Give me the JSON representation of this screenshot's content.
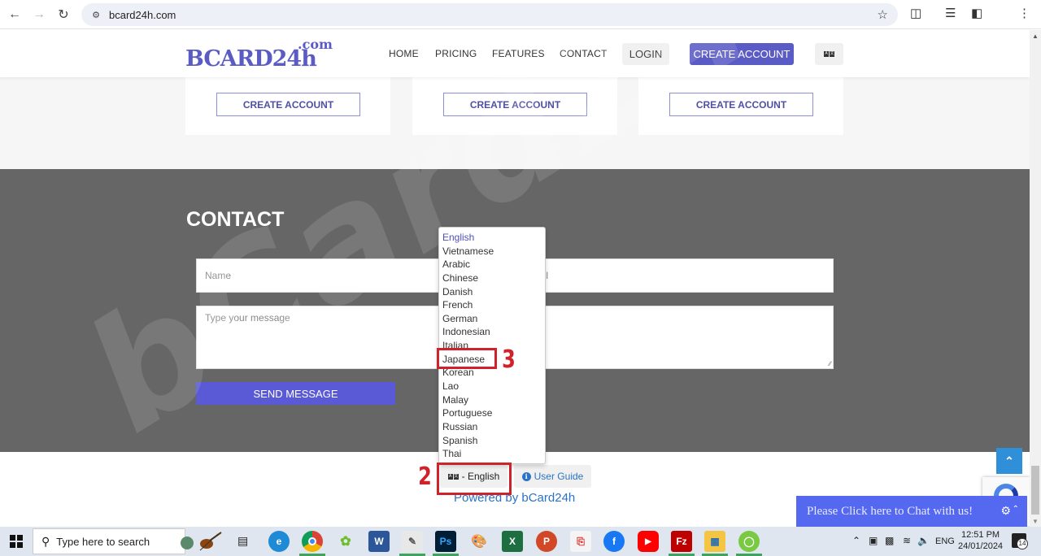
{
  "browser": {
    "url": "bcard24h.com",
    "icons": [
      "back-arrow",
      "forward-arrow",
      "reload",
      "site-info",
      "bookmark-star",
      "extensions",
      "media-control",
      "side-panel",
      "menu-kebab"
    ]
  },
  "header": {
    "logo_main": "BCARD",
    "logo_suffix": "24h",
    "logo_dotcom": ".com",
    "nav": [
      "HOME",
      "PRICING",
      "FEATURES",
      "CONTACT"
    ],
    "login_label": "LOGIN",
    "create_account_label": "CREATE ACCOUNT",
    "language_icon": "translate-icon"
  },
  "pricing": {
    "cards": [
      {
        "button_label": "CREATE ACCOUNT"
      },
      {
        "button_label": "CREATE ACCOUNT"
      },
      {
        "button_label": "CREATE ACCOUNT"
      }
    ]
  },
  "contact": {
    "title": "CONTACT",
    "name_placeholder": "Name",
    "email_placeholder": "Email",
    "message_placeholder": "Type your message",
    "send_label": "SEND MESSAGE"
  },
  "language_dropdown": {
    "selected": "English",
    "options": [
      "English",
      "Vietnamese",
      "Arabic",
      "Chinese",
      "Danish",
      "French",
      "German",
      "Indonesian",
      "Italian",
      "Japanese",
      "Korean",
      "Lao",
      "Malay",
      "Portuguese",
      "Russian",
      "Spanish",
      "Thai"
    ]
  },
  "footer": {
    "language_button_label": "- English",
    "user_guide_label": "User Guide",
    "powered_by": "Powered by bCard24h"
  },
  "annotations": {
    "step2": "2",
    "step3": "3",
    "color": "#d0222a"
  },
  "chat": {
    "label": "Please Click here to Chat with us!"
  },
  "watermark": "bCard24h.Com",
  "taskbar": {
    "search_placeholder": "Type here to search",
    "tray_language": "ENG",
    "time": "12:51 PM",
    "date": "24/01/2024",
    "notification_count": "14"
  },
  "colors": {
    "brand": "#5b5bc6",
    "contact_bg": "#666666",
    "chat_bar": "#5468f0",
    "link": "#2a73c7"
  }
}
